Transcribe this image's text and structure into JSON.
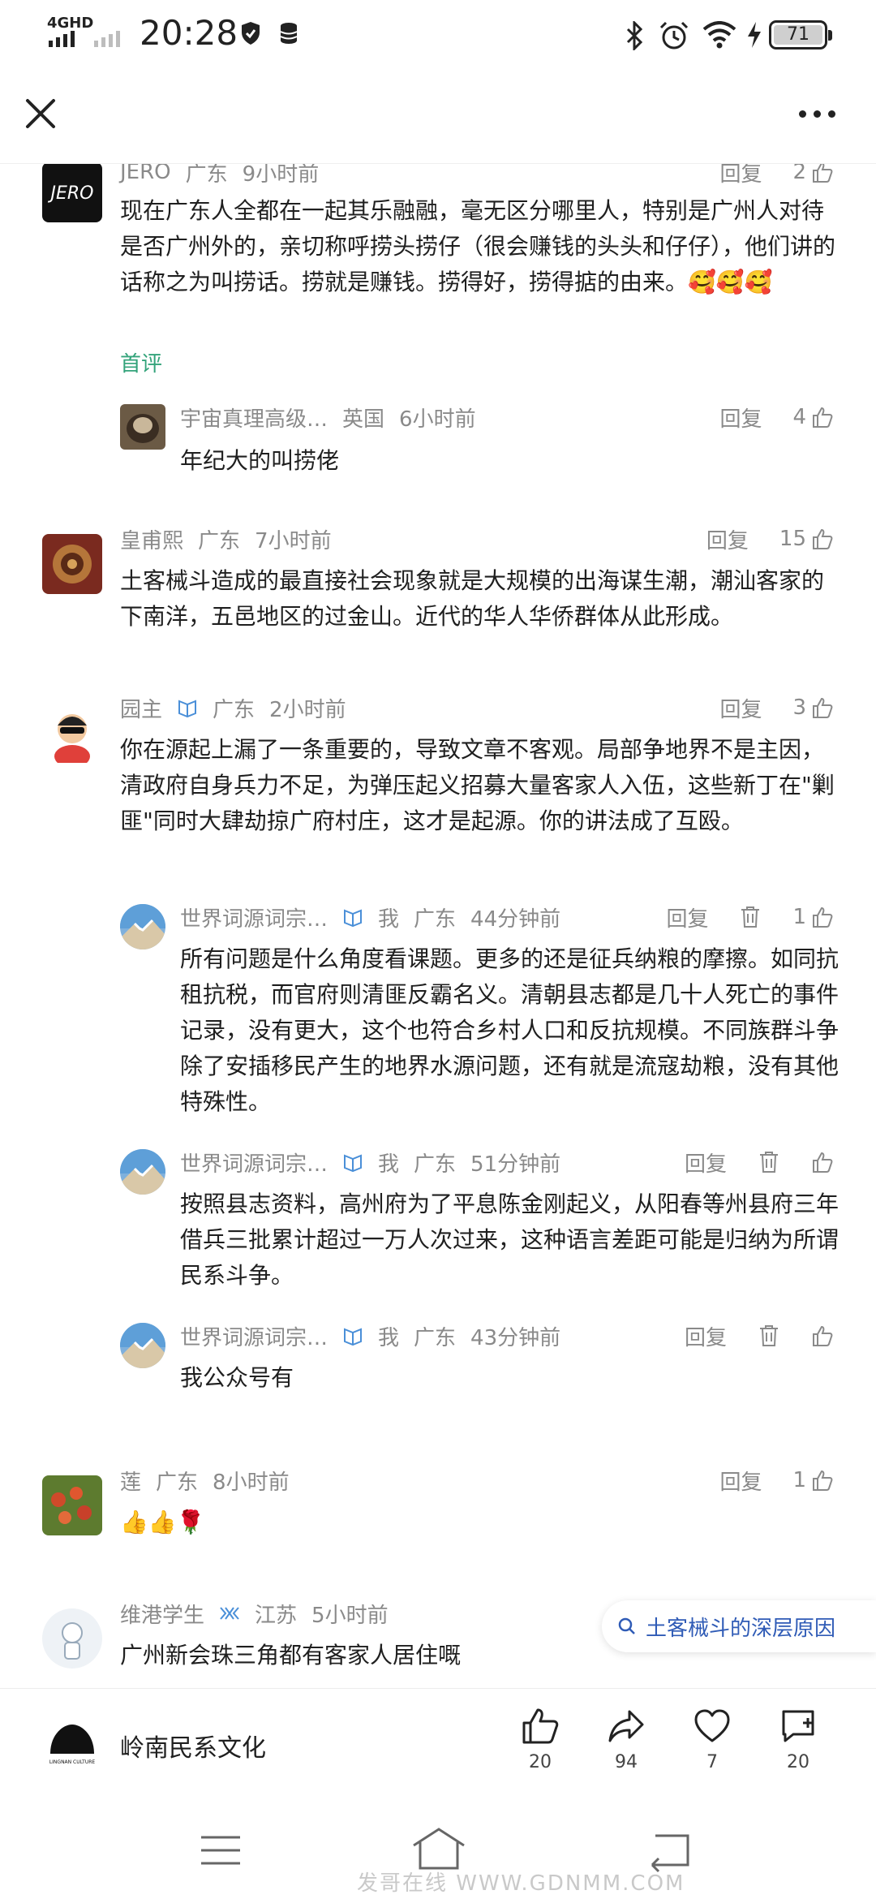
{
  "status_bar": {
    "network": "4GHD",
    "time": "20:28",
    "battery": "71"
  },
  "comments": [
    {
      "author": "JERO",
      "region": "广东",
      "time": "9小时前",
      "reply_label": "回复",
      "likes": "2",
      "text": "现在广东人全都在一起其乐融融，毫无区分哪里人，特别是广州人对待是否广州外的，亲切称呼捞头捞仔（很会赚钱的头头和仔仔），他们讲的话称之为叫捞话。捞就是赚钱。捞得好，捞得掂的由来。🥰🥰🥰",
      "tag": "首评",
      "replies": [
        {
          "author": "宇宙真理高级…",
          "region": "英国",
          "time": "6小时前",
          "reply_label": "回复",
          "likes": "4",
          "text": "年纪大的叫捞佬"
        }
      ]
    },
    {
      "author": "皇甫熙",
      "region": "广东",
      "time": "7小时前",
      "reply_label": "回复",
      "likes": "15",
      "text": "土客械斗造成的最直接社会现象就是大规模的出海谋生潮，潮汕客家的下南洋，五邑地区的过金山。近代的华人华侨群体从此形成。"
    },
    {
      "author": "园主",
      "region": "广东",
      "time": "2小时前",
      "reply_label": "回复",
      "likes": "3",
      "text": "你在源起上漏了一条重要的，导致文章不客观。局部争地界不是主因，清政府自身兵力不足，为弹压起义招募大量客家人入伍，这些新丁在\"剿匪\"同时大肆劫掠广府村庄，这才是起源。你的讲法成了互殴。",
      "replies": [
        {
          "author": "世界词源词宗…",
          "me": "我",
          "region": "广东",
          "time": "44分钟前",
          "reply_label": "回复",
          "likes": "1",
          "text": "所有问题是什么角度看课题。更多的还是征兵纳粮的摩擦。如同抗租抗税，而官府则清匪反霸名义。清朝县志都是几十人死亡的事件记录，没有更大，这个也符合乡村人口和反抗规模。不同族群斗争除了安插移民产生的地界水源问题，还有就是流寇劫粮，没有其他特殊性。"
        },
        {
          "author": "世界词源词宗…",
          "me": "我",
          "region": "广东",
          "time": "51分钟前",
          "reply_label": "回复",
          "likes": "",
          "text": "按照县志资料，高州府为了平息陈金刚起义，从阳春等州县府三年借兵三批累计超过一万人次过来，这种语言差距可能是归纳为所谓民系斗争。"
        },
        {
          "author": "世界词源词宗…",
          "me": "我",
          "region": "广东",
          "time": "43分钟前",
          "reply_label": "回复",
          "likes": "",
          "text": "我公众号有"
        }
      ]
    },
    {
      "author": "莲",
      "region": "广东",
      "time": "8小时前",
      "reply_label": "回复",
      "likes": "1",
      "text": "👍👍🌹"
    },
    {
      "author": "维港学生",
      "region": "江苏",
      "time": "5小时前",
      "text": "广州新会珠三角都有客家人居住嘅"
    }
  ],
  "search_chip": {
    "query": "土客械斗的深层原因"
  },
  "bottom_bar": {
    "brand_name": "岭南民系文化",
    "logo_text": "LINGNAN CULTURE",
    "like_count": "20",
    "share_count": "94",
    "favorite_count": "7",
    "comment_count": "20"
  },
  "watermark": "发哥在线 WWW.GDNMM.COM"
}
